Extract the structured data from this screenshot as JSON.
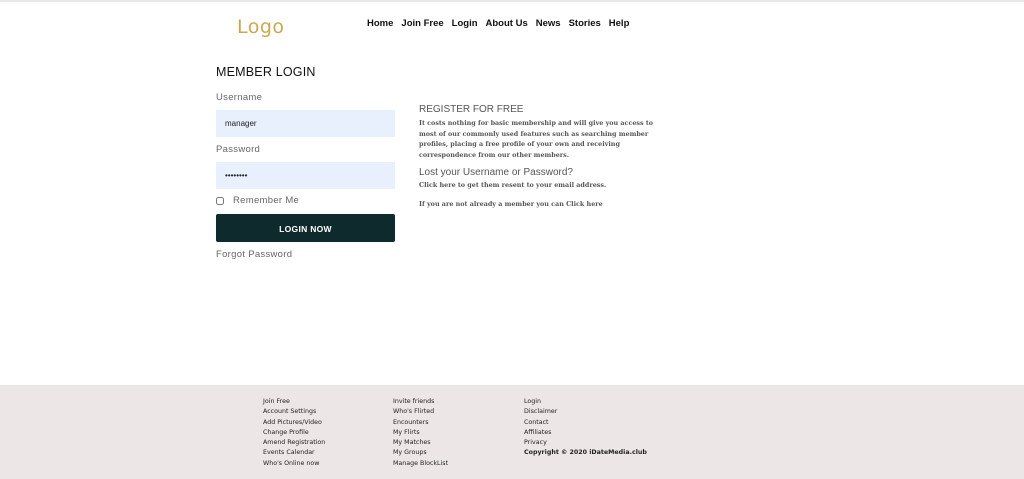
{
  "header": {
    "logo": "Logo",
    "nav": [
      "Home",
      "Join Free",
      "Login",
      "About Us",
      "News",
      "Stories",
      "Help"
    ]
  },
  "login": {
    "title": "MEMBER LOGIN",
    "username_label": "Username",
    "username_value": "manager",
    "password_label": "Password",
    "password_value": "password",
    "remember_label": "Remember Me",
    "remember_checked": false,
    "button_label": "LOGIN NOW",
    "forgot_label": "Forgot Password"
  },
  "info": {
    "register_title": "REGISTER FOR FREE",
    "register_text": "It costs nothing for basic membership and will give you access to most of our commonly used features such as searching member profiles, placing a free profile of your own and receiving correspondence from our other members.",
    "lost_title": "Lost your Username or Password?",
    "lost_text": "Click here to get them resent to your email address.",
    "member_text": "If you are not already a member you can Click here"
  },
  "footer": {
    "col1": [
      "Join Free",
      "Account Settings",
      "Add Pictures/Video",
      "Change Profile",
      "Amend Registration",
      "Events Calendar",
      "Who's Online now"
    ],
    "col2": [
      "Invite friends",
      "Who's Flirted",
      "Encounters",
      "My Flirts",
      "My Matches",
      "My Groups",
      "Manage BlockList"
    ],
    "col3": [
      "Login",
      "Disclaimer",
      "Contact",
      "Affiliates",
      "Privacy"
    ],
    "copyright": "Copyright © 2020 iDateMedia.club"
  },
  "colors": {
    "logo": "#c9a850",
    "button_bg": "#0e2a2d",
    "input_bg": "#e8f0fe",
    "footer_bg": "#ede6e6"
  }
}
